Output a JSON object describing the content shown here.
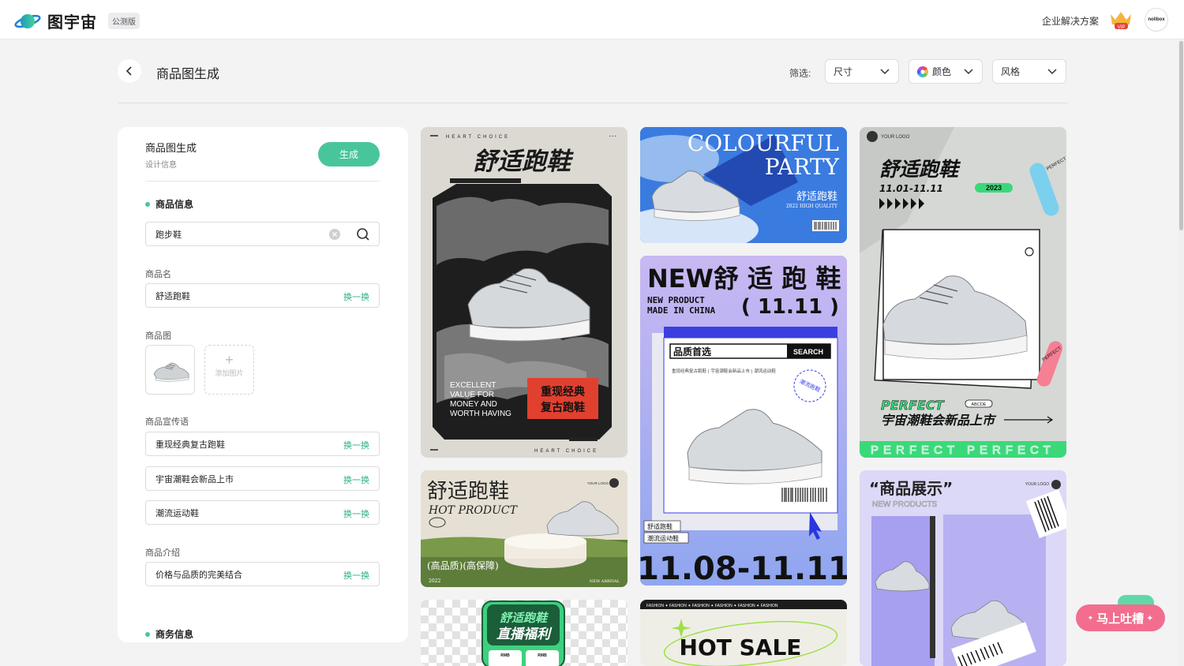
{
  "header": {
    "brand_name": "图宇宙",
    "beta_badge": "公测版",
    "enterprise_link": "企业解决方案",
    "vip_label": "VIP",
    "avatar_text": "nolibox"
  },
  "page": {
    "title": "商品图生成"
  },
  "filters": {
    "label": "筛选:",
    "size": "尺寸",
    "color": "颜色",
    "style": "风格"
  },
  "panel": {
    "title": "商品图生成",
    "subtitle": "设计信息",
    "generate_button": "生成",
    "product_info_heading": "商品信息",
    "search_value": "跑步鞋",
    "name_label": "商品名",
    "name_value": "舒适跑鞋",
    "swap_label": "换一换",
    "image_label": "商品图",
    "add_image_label": "添加图片",
    "slogan_label": "商品宣传语",
    "slogans": [
      "重现经典复古跑鞋",
      "宇宙潮鞋会新品上市",
      "潮流运动鞋"
    ],
    "intro_label": "商品介绍",
    "intro_value": "价格与品质的完美结合",
    "business_heading": "商务信息"
  },
  "cards": {
    "c1": {
      "top": "HEART CHOICE",
      "title": "舒适跑鞋",
      "en_lines": [
        "EXCELLENT",
        "VALUE FOR",
        "MONEY AND",
        "WORTH HAVING"
      ],
      "tag1": "重现经典",
      "tag2": "复古跑鞋",
      "bottom": "HEART CHOICE"
    },
    "c2": {
      "line1": "COLOURFUL",
      "line2": "PARTY",
      "cn": "舒适跑鞋",
      "sub": "2022 HIGH QUALITY"
    },
    "c3": {
      "title": "NEW舒 适 跑 鞋",
      "sub1": "NEW PRODUCT",
      "sub2": "MADE IN CHINA",
      "date_big": "( 11.11 )",
      "search_text": "品质首选",
      "search_btn": "SEARCH",
      "desc": "重现经典复古跑鞋 | 宇宙潮鞋会新品上市 | 潮流运动鞋",
      "stamp": "潮流跑鞋",
      "tag1": "舒适跑鞋",
      "tag2": "潮流运动鞋",
      "footer": "11.08-11.11"
    },
    "c4": {
      "logo": "YOUR LOGO",
      "title": "舒适跑鞋",
      "date": "11.01-11.11",
      "year": "2023",
      "badge": "PERFECT",
      "perfect": "PERFECT",
      "abcde": "ABCDE",
      "slogan": "宇宙潮鞋会新品上市",
      "footer": "PERFECT PERFECT"
    },
    "c5": {
      "title": "舒适跑鞋",
      "logo": "YOUR LOGO",
      "sub": "HOT PRODUCT",
      "tags": "(高品质)(高保障)",
      "year": "2022",
      "arrival": "NEW ARRIVAL"
    },
    "c6": {
      "title": "“商品展示”",
      "sub": "NEW PRODUCTS",
      "logo": "YOUR LOGO"
    },
    "c7": {
      "line1": "舒适跑鞋",
      "line2": "直播福利",
      "price_label": "RMB"
    },
    "c8": {
      "ticker": "FASHION ✦ FASHION ✦ FASHION ✦ FASHION ✦ FASHION ✦ FASHION",
      "title": "HOT SALE"
    }
  },
  "feedback": {
    "label": "马上吐槽"
  },
  "colors": {
    "accent": "#49c59c",
    "feedback": "#f26d8e"
  }
}
